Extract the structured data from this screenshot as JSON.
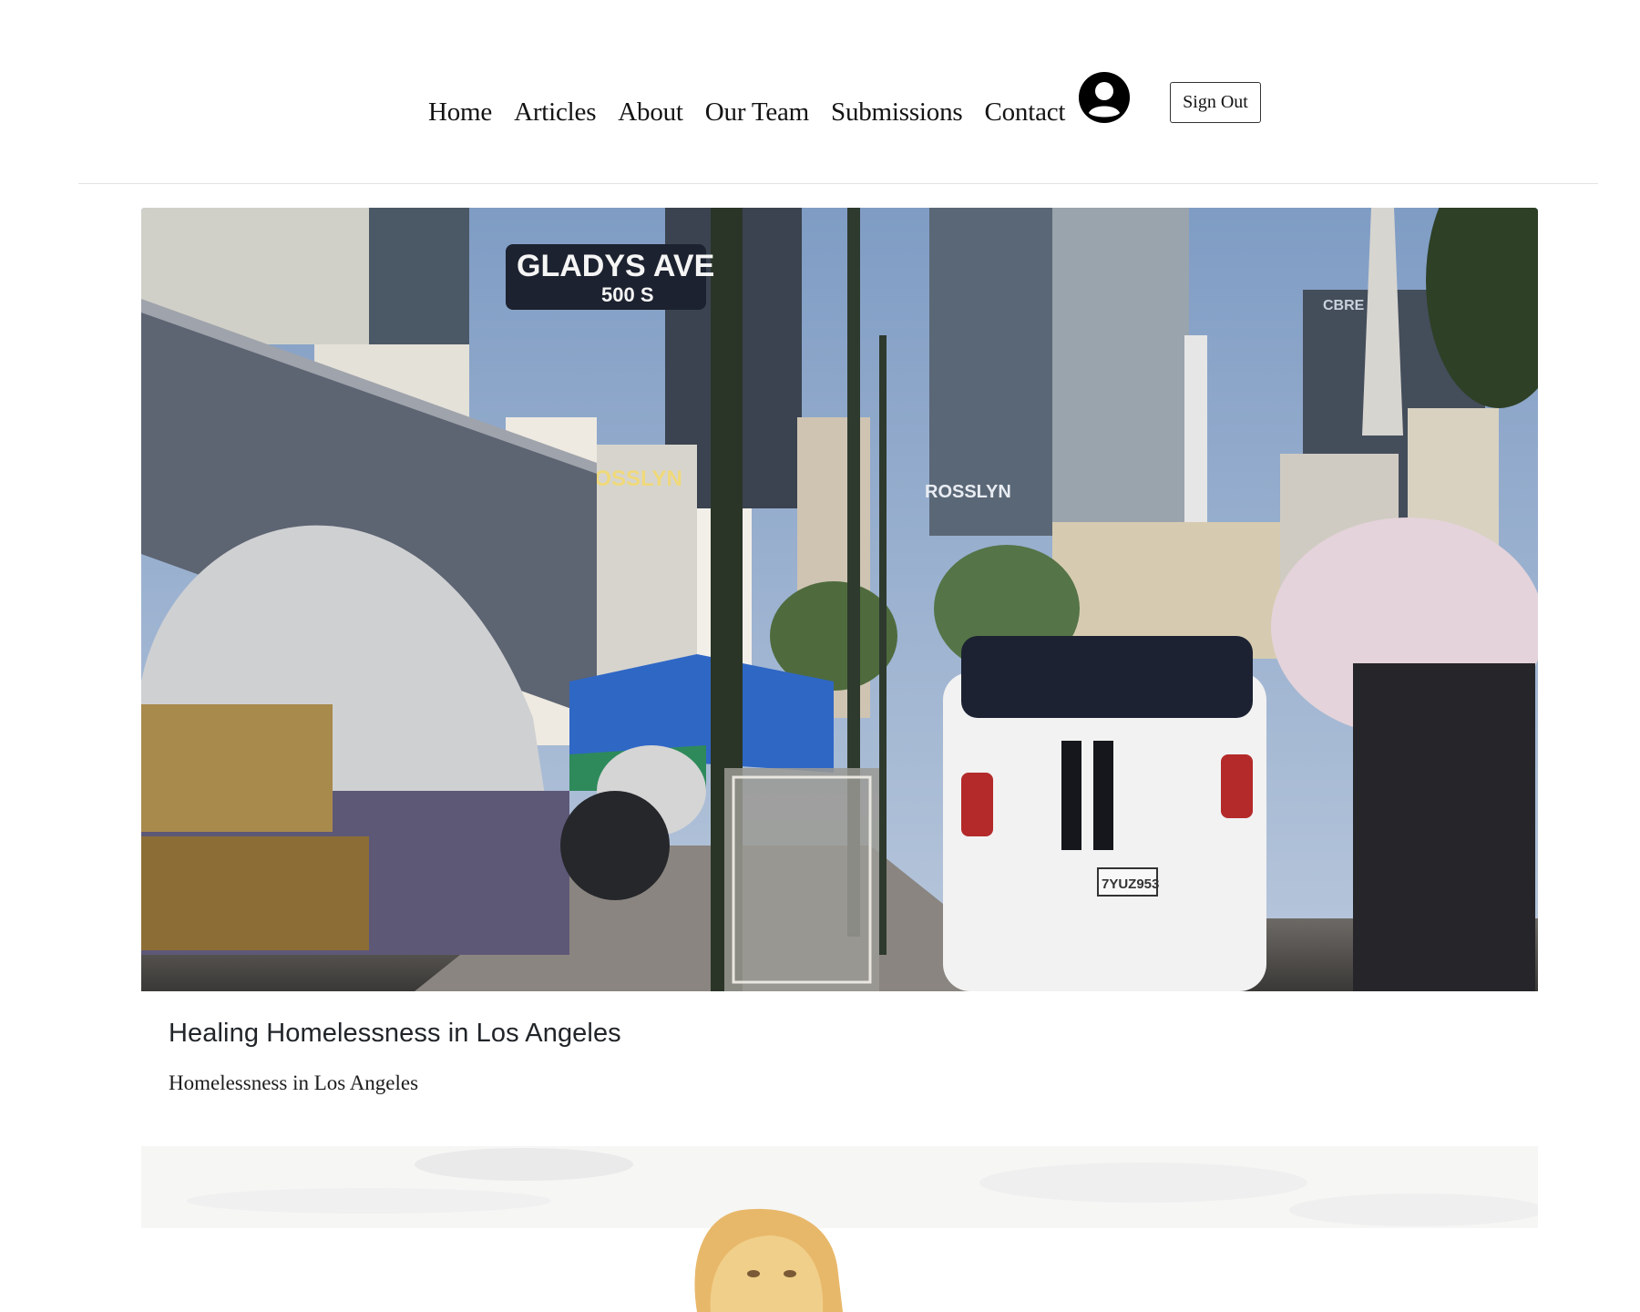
{
  "nav": {
    "items": [
      {
        "label": "Home"
      },
      {
        "label": "Articles"
      },
      {
        "label": "About"
      },
      {
        "label": "Our Team"
      },
      {
        "label": "Submissions"
      },
      {
        "label": "Contact"
      }
    ],
    "account_icon": "user-circle-icon",
    "sign_out_label": "Sign Out"
  },
  "articles": [
    {
      "title": "Healing Homelessness in Los Angeles",
      "description": "Homelessness in Los Angeles",
      "image": {
        "subject": "street-photo",
        "street_sign_name": "GLADYS AVE",
        "street_sign_number": "500 S",
        "rooftop_sign_left": "ROSSLYN",
        "rooftop_sign_right": "ROSSLYN",
        "tower_sign": "CBRE",
        "license_plate": "7YUZ953"
      }
    },
    {
      "title": "",
      "description": "",
      "image": {
        "subject": "drawing"
      }
    }
  ],
  "colors": {
    "header_rule": "#e3e3e3",
    "title_text": "#212529",
    "sky": "#8ea8cc"
  }
}
